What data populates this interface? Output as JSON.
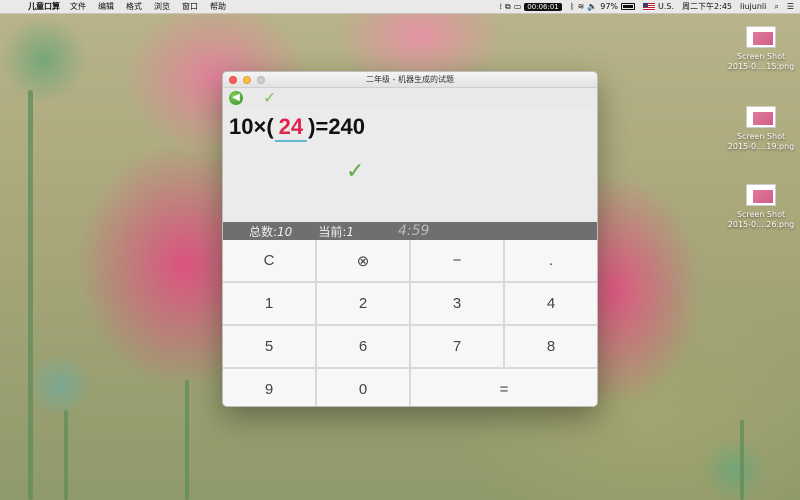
{
  "menubar": {
    "apple_symbol": "",
    "app_name": "儿童口算",
    "items": [
      "文件",
      "编辑",
      "格式",
      "浏览",
      "窗口",
      "帮助"
    ],
    "status": {
      "timer": "00:06:01",
      "battery_percent": "97%",
      "input_source": "U.S.",
      "clock": "周二下午2:45",
      "user": "liujunli",
      "search_icon": "search-icon",
      "list_icon": "list-icon"
    }
  },
  "desktop_icons": [
    {
      "label_line1": "Screen Shot",
      "label_line2": "2015-0....15.png"
    },
    {
      "label_line1": "Screen Shot",
      "label_line2": "2015-0....19.png"
    },
    {
      "label_line1": "Screen Shot",
      "label_line2": "2015-0....26.png"
    }
  ],
  "window": {
    "title": "二年级 - 机器生成的试题",
    "toolbar": {
      "back_symbol": "◀",
      "check_symbol": "✓"
    },
    "question": {
      "prefix": "10×(",
      "answer": "24",
      "suffix": ")=240",
      "result_symbol": "✓"
    },
    "stats": {
      "total_label": "总数:",
      "total_value": "10",
      "current_label": "当前:",
      "current_value": "1",
      "countdown": "4:59"
    },
    "keypad": {
      "row1": [
        "C",
        "⊗",
        "−",
        "."
      ],
      "row2": [
        "1",
        "2",
        "3",
        "4"
      ],
      "row3": [
        "5",
        "6",
        "7",
        "8"
      ],
      "row4": [
        "9",
        "0",
        "="
      ]
    }
  },
  "colors": {
    "answer": "#e2264b",
    "answer_underline": "#65b7d5",
    "check_green": "#5faa3e",
    "stats_bar": "#6f6f6f"
  }
}
